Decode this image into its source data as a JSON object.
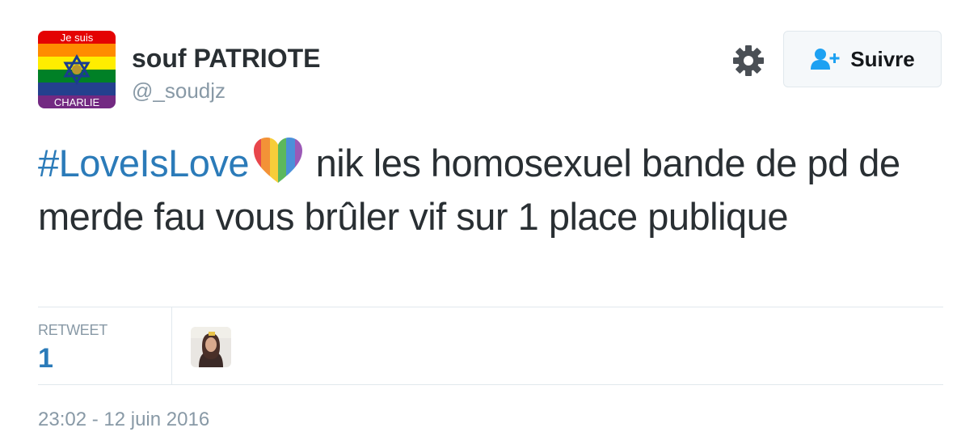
{
  "author": {
    "display_name": "souf PATRIOTE",
    "handle": "@_soudjz",
    "avatar": {
      "icon": "rainbow-flag-avatar",
      "top_text": "Je suis",
      "bottom_text": "CHARLIE",
      "emblem": "star-of-david-icon"
    }
  },
  "actions": {
    "settings_icon": "gear-icon",
    "follow_icon": "add-user-icon",
    "follow_label": "Suivre"
  },
  "tweet": {
    "hashtag": "#LoveIsLove",
    "emoji": "rainbow-heart-icon",
    "text": "nik les homosexuel bande de pd de merde fau vous brûler vif sur 1 place publique"
  },
  "stats": {
    "retweet_label": "RETWEET",
    "retweet_count": "1",
    "retweeter_avatar_icon": "user-avatar"
  },
  "timestamp": "23:02 - 12 juin 2016",
  "colors": {
    "link": "#2b7bb9",
    "secondary_text": "#8899a6",
    "primary_text": "#292f33",
    "border": "#e1e8ed",
    "button_bg": "#f5f8fa"
  }
}
